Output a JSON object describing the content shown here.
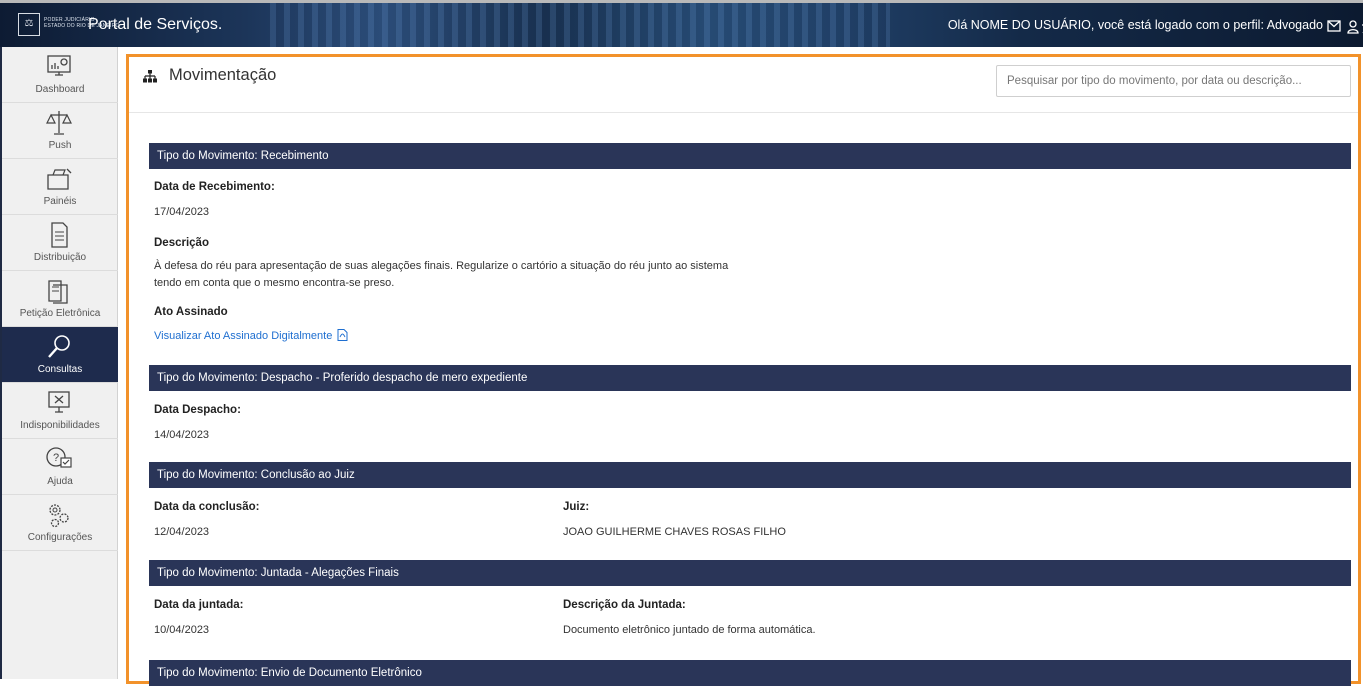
{
  "header": {
    "logo_glyph": "⚖",
    "logo_text_line1": "PODER JUDICIÁRIO",
    "logo_text_line2": "ESTADO DO RIO DE JANEIRO",
    "portal_title": "Portal de Serviços.",
    "user_greeting": "Olá NOME DO USUÁRIO, você está logado com o perfil: Advogado",
    "icons": [
      "mail-icon",
      "user-icon",
      "accessibility-icon"
    ]
  },
  "sidebar": {
    "items": [
      {
        "label": "Dashboard",
        "icon": "dashboard-icon"
      },
      {
        "label": "Push",
        "icon": "scales-icon"
      },
      {
        "label": "Painéis",
        "icon": "panels-icon"
      },
      {
        "label": "Distribuição",
        "icon": "document-icon"
      },
      {
        "label": "Petição Eletrônica",
        "icon": "folder-icon"
      },
      {
        "label": "Consultas",
        "icon": "magnifier-icon",
        "active": true
      },
      {
        "label": "Indisponibilidades",
        "icon": "unavailable-monitor-icon"
      },
      {
        "label": "Ajuda",
        "icon": "help-icon"
      },
      {
        "label": "Configurações",
        "icon": "gears-icon"
      }
    ]
  },
  "main": {
    "title": "Movimentação",
    "search_placeholder": "Pesquisar por tipo do movimento, por data ou descrição...",
    "movements": [
      {
        "type": "Tipo do Movimento: Recebimento",
        "fields": [
          {
            "label": "Data de Recebimento:",
            "value": "17/04/2023"
          },
          {
            "label": "Descrição",
            "value_line1": "À defesa do réu para apresentação de suas alegações finais. Regularize o cartório a situação do réu junto ao sistema",
            "value_line2": "tendo em conta que o mesmo encontra-se preso."
          },
          {
            "label": "Ato Assinado",
            "link": "Visualizar Ato Assinado Digitalmente"
          }
        ]
      },
      {
        "type": "Tipo do Movimento: Despacho - Proferido despacho de mero expediente",
        "fields": [
          {
            "label": "Data Despacho:",
            "value": "14/04/2023"
          }
        ]
      },
      {
        "type": "Tipo do Movimento: Conclusão ao Juiz",
        "fields": [
          {
            "label": "Data da conclusão:",
            "value": "12/04/2023"
          },
          {
            "label": "Juiz:",
            "value": "JOAO GUILHERME CHAVES ROSAS FILHO"
          }
        ]
      },
      {
        "type": "Tipo do Movimento: Juntada - Alegações Finais",
        "fields": [
          {
            "label": "Data da juntada:",
            "value": "10/04/2023"
          },
          {
            "label": "Descrição da Juntada:",
            "value": "Documento eletrônico juntado de forma automática."
          }
        ]
      },
      {
        "type": "Tipo do Movimento: Envio de Documento Eletrônico",
        "fields": []
      }
    ]
  },
  "colors": {
    "accent_border": "#f2922a",
    "movement_bar": "#2a3558",
    "active_nav": "#1e2b4d",
    "link": "#1f6fd0"
  }
}
